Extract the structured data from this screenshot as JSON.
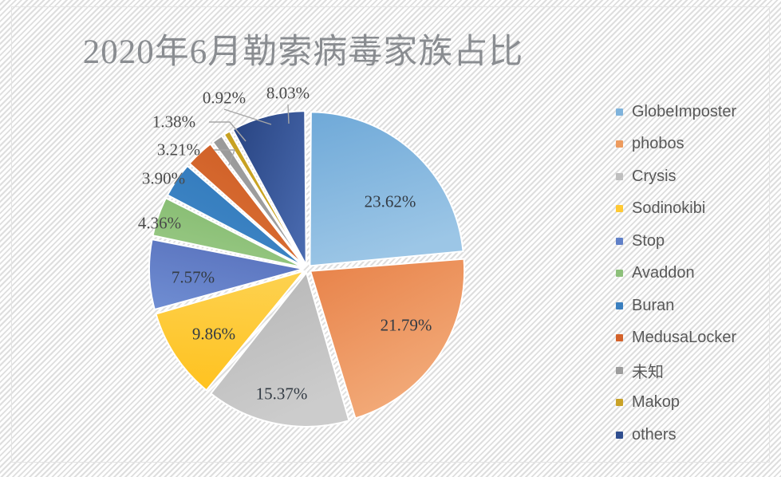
{
  "chart_data": {
    "type": "pie",
    "title": "2020年6月勒索病毒家族占比",
    "xlabel": "",
    "ylabel": "",
    "legend_position": "right",
    "grid": false,
    "value_suffix": "%",
    "categories": [
      "GlobeImposter",
      "phobos",
      "Crysis",
      "Sodinokibi",
      "Stop",
      "Avaddon",
      "Buran",
      "MedusaLocker",
      "未知",
      "Makop",
      "others"
    ],
    "values": [
      23.62,
      21.79,
      15.37,
      9.86,
      7.57,
      4.36,
      3.9,
      3.21,
      1.38,
      0.92,
      8.03
    ],
    "labels": [
      "23.62%",
      "21.79%",
      "15.37%",
      "9.86%",
      "7.57%",
      "4.36%",
      "3.90%",
      "3.21%",
      "1.38%",
      "0.92%",
      "8.03%"
    ],
    "colors": [
      "#7fb3dc",
      "#ed9b5e",
      "#bfbfbf",
      "#ffc933",
      "#6080c8",
      "#8dc07a",
      "#3a7fbf",
      "#d4622a",
      "#9c9c9c",
      "#c9a227",
      "#2f4e8f"
    ],
    "label_placement": [
      "inner",
      "inner",
      "inner",
      "inner",
      "inner",
      "outer",
      "outer",
      "outer",
      "outer",
      "outer",
      "outer"
    ],
    "start_angle_deg": 0,
    "direction": "clockwise"
  },
  "legend": {
    "items": [
      {
        "label": "GlobeImposter",
        "color": "#7fb3dc"
      },
      {
        "label": "phobos",
        "color": "#ed9b5e"
      },
      {
        "label": "Crysis",
        "color": "#bfbfbf"
      },
      {
        "label": "Sodinokibi",
        "color": "#ffc933"
      },
      {
        "label": "Stop",
        "color": "#6080c8"
      },
      {
        "label": "Avaddon",
        "color": "#8dc07a"
      },
      {
        "label": "Buran",
        "color": "#3a7fbf"
      },
      {
        "label": "MedusaLocker",
        "color": "#d4622a"
      },
      {
        "label": "未知",
        "color": "#9c9c9c"
      },
      {
        "label": "Makop",
        "color": "#c9a227"
      },
      {
        "label": "others",
        "color": "#2f4e8f"
      }
    ]
  }
}
